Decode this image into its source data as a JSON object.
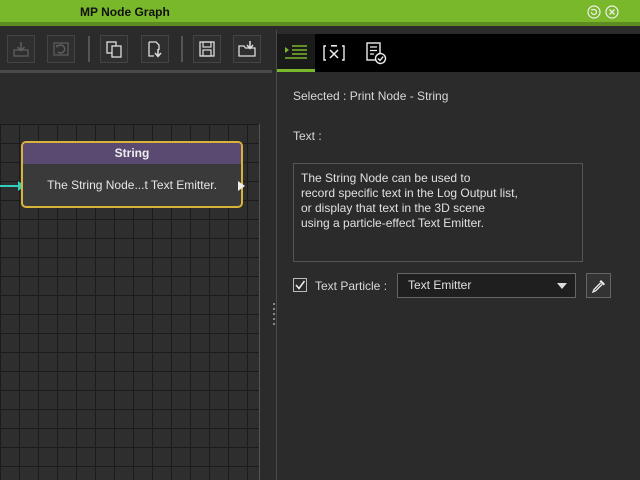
{
  "window": {
    "title": "MP Node Graph",
    "accent_color": "#7ab82b",
    "buttons": [
      {
        "icon": "refresh-icon"
      },
      {
        "icon": "close-icon"
      }
    ]
  },
  "toolbar": {
    "items": [
      {
        "icon": "import-icon",
        "enabled": false
      },
      {
        "icon": "undo-icon",
        "enabled": false
      },
      {
        "icon": "copy-icon",
        "enabled": true
      },
      {
        "icon": "paste-icon",
        "enabled": true
      },
      {
        "icon": "save-icon",
        "enabled": true
      },
      {
        "icon": "load-folder-icon",
        "enabled": true
      }
    ]
  },
  "graph": {
    "node": {
      "header": "String",
      "header_color": "#5a4a72",
      "border_color": "#d8b23a",
      "body_text": "The String Node...t Text Emitter."
    },
    "edge_color": "#2fd0c0"
  },
  "panel": {
    "tabs": [
      {
        "icon": "properties-icon",
        "active": true
      },
      {
        "icon": "variables-icon",
        "active": false
      },
      {
        "icon": "log-checklist-icon",
        "active": false
      }
    ],
    "selected_label": "Selected : Print Node - String",
    "text_label": "Text :",
    "text_value": "The String Node can be used to\nrecord specific text in the Log Output list,\nor display that text in the 3D scene\nusing a particle-effect Text Emitter.",
    "text_particle": {
      "checked": true,
      "label": "Text Particle :",
      "selected_option": "Text Emitter"
    }
  }
}
